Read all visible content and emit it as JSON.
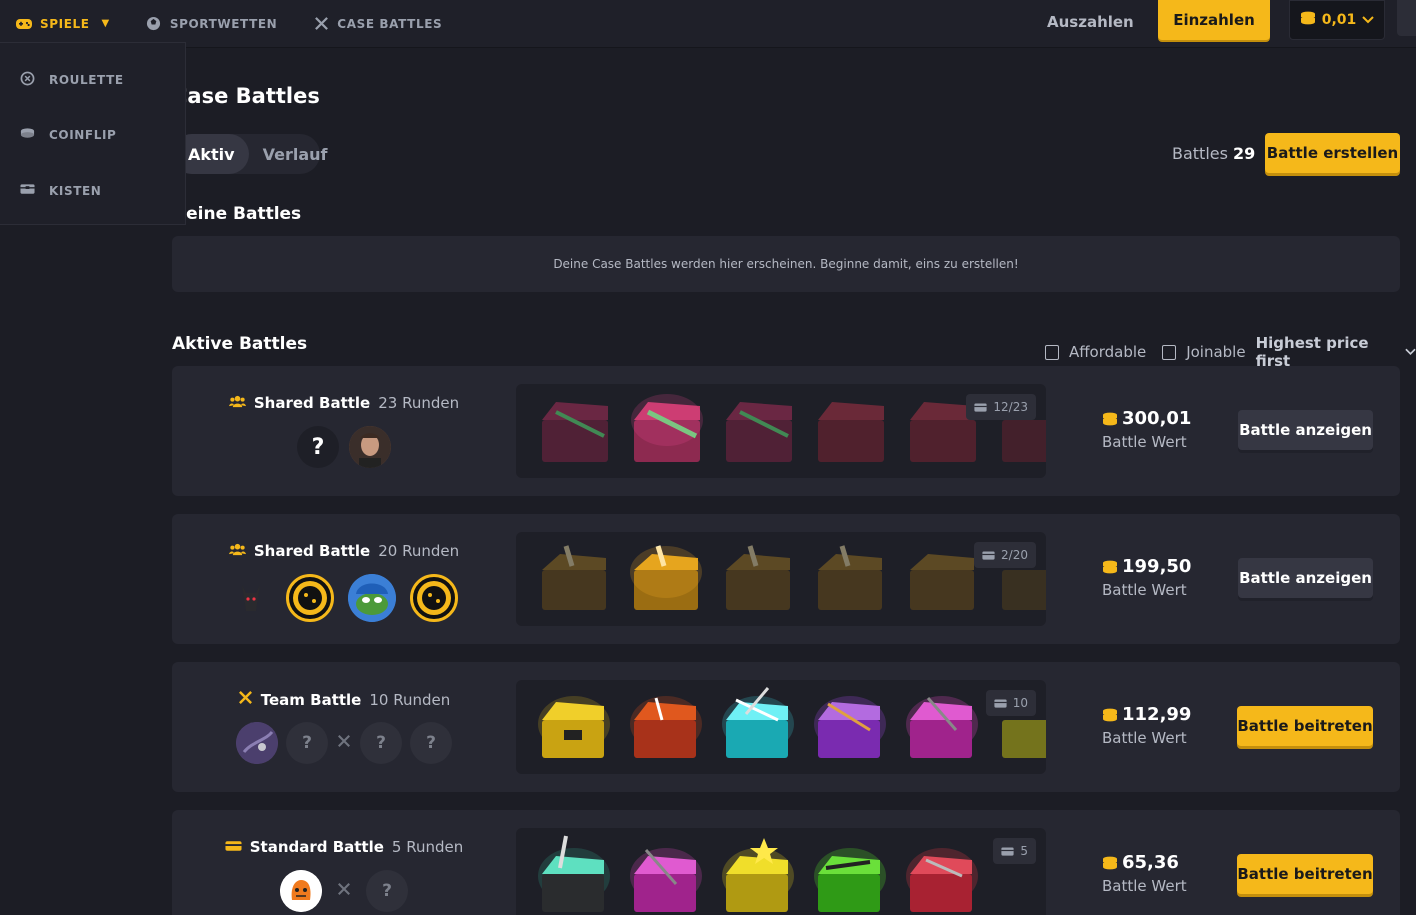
{
  "nav": {
    "spiele": "SPIELE",
    "sportwetten": "SPORTWETTEN",
    "case_battles": "CASE BATTLES",
    "auszahlen": "Auszahlen",
    "einzahlen": "Einzahlen",
    "balance": "0,01"
  },
  "dropdown": {
    "items": [
      {
        "label": "ROULETTE",
        "icon": "roulette-icon"
      },
      {
        "label": "COINFLIP",
        "icon": "coin-icon"
      },
      {
        "label": "KISTEN",
        "icon": "crate-icon"
      }
    ]
  },
  "page": {
    "title": "Case Battles",
    "tabs": [
      "Aktiv",
      "Verlauf"
    ],
    "battles_label": "Battles",
    "battles_count": "29",
    "create_button": "Battle erstellen"
  },
  "my_battles": {
    "title": "Deine Battles",
    "empty_text": "Deine Case Battles werden hier erscheinen. Beginne damit, eins zu erstellen!"
  },
  "active_battles": {
    "title": "Aktive Battles",
    "filter_affordable": "Affordable",
    "filter_joinable": "Joinable",
    "sort": "Highest price first",
    "value_label": "Battle Wert",
    "battles": [
      {
        "type": "Shared Battle",
        "rounds": "23 Runden",
        "counter": "12/23",
        "value": "300,01",
        "button": "Battle anzeigen",
        "joinable": false,
        "case_color": "#c23a6a"
      },
      {
        "type": "Shared Battle",
        "rounds": "20 Runden",
        "counter": "2/20",
        "value": "199,50",
        "button": "Battle anzeigen",
        "joinable": false,
        "case_color": "#c98a1e"
      },
      {
        "type": "Team Battle",
        "rounds": "10 Runden",
        "counter": "10",
        "value": "112,99",
        "button": "Battle beitreten",
        "joinable": true,
        "case_color": "#b36be0"
      },
      {
        "type": "Standard Battle",
        "rounds": "5 Runden",
        "counter": "5",
        "value": "65,36",
        "button": "Battle beitreten",
        "joinable": true,
        "case_color": "#38c9a8"
      }
    ]
  },
  "colors": {
    "accent": "#f5b81a",
    "background": "#1c1d25",
    "card": "#262731"
  }
}
